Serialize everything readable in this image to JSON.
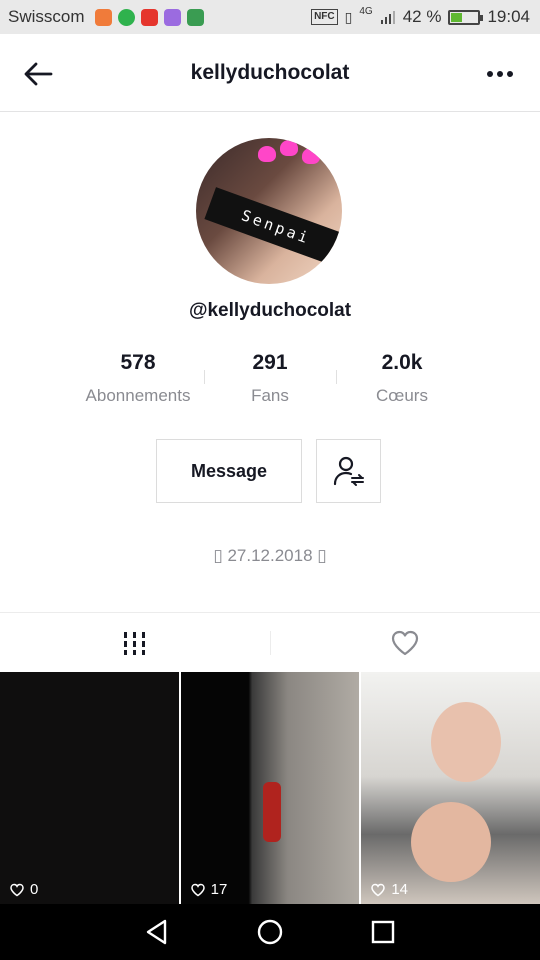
{
  "statusbar": {
    "carrier": "Swisscom",
    "nfc": "NFC",
    "network": "4G",
    "battery": "42 %",
    "time": "19:04",
    "battery_level": 0.42
  },
  "header": {
    "title": "kellyduchocolat"
  },
  "profile": {
    "avatar_overlay_text": "Senpai",
    "username": "@kellyduchocolat",
    "stats": [
      {
        "value": "578",
        "label": "Abonnements"
      },
      {
        "value": "291",
        "label": "Fans"
      },
      {
        "value": "2.0k",
        "label": "Cœurs"
      }
    ],
    "message_label": "Message",
    "birthday": "▯ 27.12.2018 ▯"
  },
  "tabs": [
    {
      "icon": "videos-grid-icon"
    },
    {
      "icon": "heart-outline-icon"
    }
  ],
  "videos": [
    {
      "likes": "0"
    },
    {
      "likes": "17"
    },
    {
      "likes": "14"
    }
  ],
  "colors": {
    "accent_text": "#161823",
    "secondary_text": "#8a8b91",
    "statusbar_bg": "#e9e9e9"
  }
}
